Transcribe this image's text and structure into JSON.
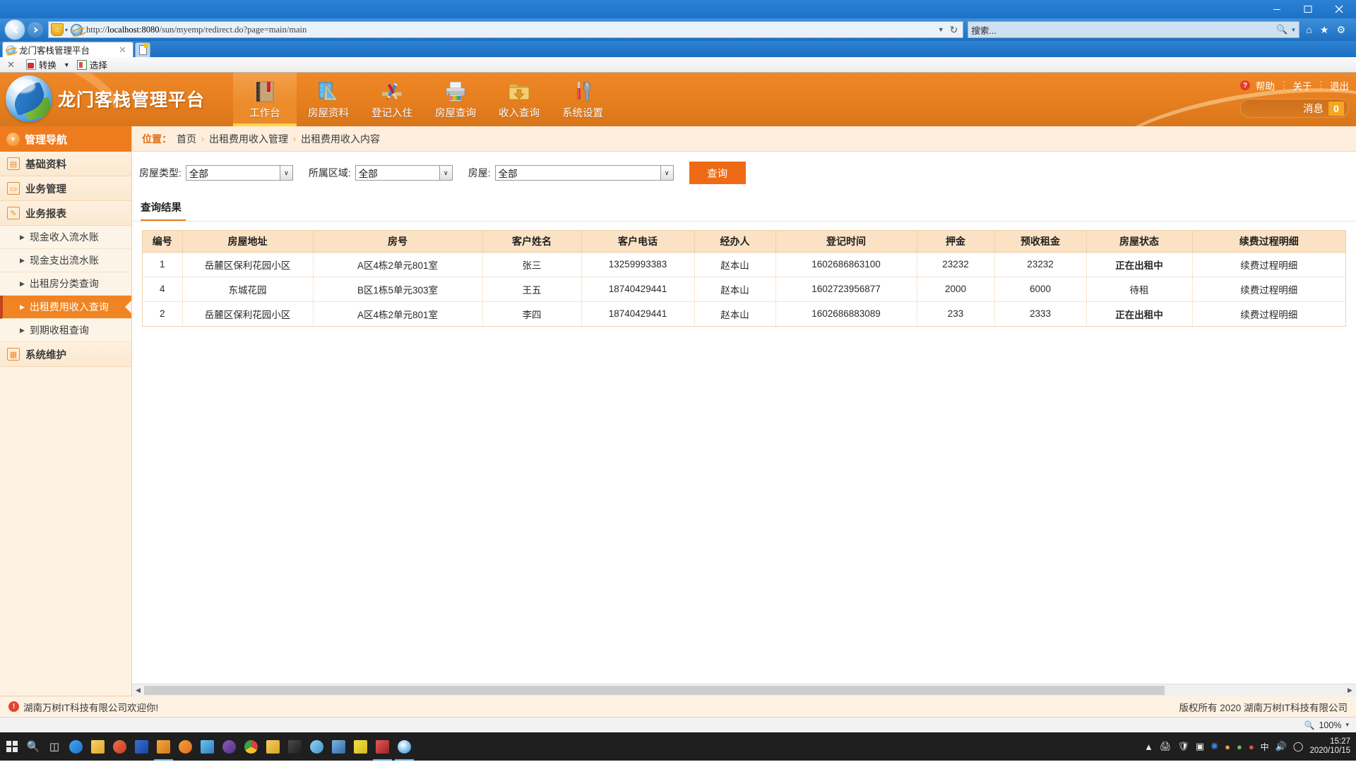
{
  "browser": {
    "url_prefix": "http://",
    "url_host": "localhost:8080",
    "url_path": "/sun/myemp/redirect.do?page=main/main",
    "url_full": "http://localhost:8080/sun/myemp/redirect.do?page=main/main",
    "search_placeholder": "搜索...",
    "tab_title": "龙门客栈管理平台",
    "tab_close": "✕",
    "addon_close": "✕",
    "addon_convert": "转换",
    "addon_select": "选择",
    "addon_caret": "▼",
    "minimize": "—",
    "maximize": "▢",
    "close": "✕",
    "refresh": "↻",
    "addr_caret": "▼",
    "search_caret": "▼",
    "icons": {
      "home": "⌂",
      "favorites": "★",
      "gear": "⚙"
    }
  },
  "app": {
    "title": "龙门客栈管理平台",
    "header_links": [
      {
        "label": "帮助",
        "icon": "question-mark"
      },
      {
        "label": "关于"
      },
      {
        "label": "退出"
      }
    ],
    "link_separator": "⋮",
    "help_badge": "?",
    "message_label": "消息",
    "message_count": "0",
    "nav": [
      {
        "label": "工作台",
        "icon": "notebook-icon",
        "active": true
      },
      {
        "label": "房屋资料",
        "icon": "ruler-triangle-icon",
        "active": false
      },
      {
        "label": "登记入住",
        "icon": "pencil-brush-icon",
        "active": false
      },
      {
        "label": "房屋查询",
        "icon": "printer-icon",
        "active": false
      },
      {
        "label": "收入查询",
        "icon": "folder-download-icon",
        "active": false
      },
      {
        "label": "系统设置",
        "icon": "wrench-screwdriver-icon",
        "active": false
      }
    ]
  },
  "sidebar": {
    "header": "管理导航",
    "groups": [
      {
        "label": "基础资料",
        "icon": "grid-icon",
        "type": "group"
      },
      {
        "label": "业务管理",
        "icon": "chat-icon",
        "type": "group"
      },
      {
        "label": "业务报表",
        "icon": "pencil-square-icon",
        "type": "group"
      },
      {
        "label": "现金收入流水账",
        "type": "sub",
        "active": false
      },
      {
        "label": "现金支出流水账",
        "type": "sub",
        "active": false
      },
      {
        "label": "出租房分类查询",
        "type": "sub",
        "active": false
      },
      {
        "label": "出租费用收入查询",
        "type": "sub",
        "active": true
      },
      {
        "label": "到期收租查询",
        "type": "sub",
        "active": false
      },
      {
        "label": "系统维护",
        "icon": "calendar-icon",
        "type": "group"
      }
    ],
    "sub_arrow": "▶"
  },
  "breadcrumb": {
    "label": "位置：",
    "items": [
      "首页",
      "出租费用收入管理",
      "出租费用收入内容"
    ],
    "separator": "›"
  },
  "filters": {
    "fields": [
      {
        "label": "房屋类型:",
        "value": "全部"
      },
      {
        "label": "所属区域:",
        "value": "全部"
      },
      {
        "label": "房屋:",
        "value": "全部"
      }
    ],
    "query_button": "查询",
    "select_caret": "∨"
  },
  "results": {
    "section_title": "查询结果",
    "columns": [
      "编号",
      "房屋地址",
      "房号",
      "客户姓名",
      "客户电话",
      "经办人",
      "登记时间",
      "押金",
      "预收租金",
      "房屋状态",
      "续费过程明细"
    ],
    "rows": [
      {
        "id": "1",
        "address": "岳麓区保利花园小区",
        "room": "A区4栋2单元801室",
        "customer": "张三",
        "phone": "13259993383",
        "agent": "赵本山",
        "reg_time": "1602686863100",
        "deposit": "23232",
        "prepaid_rent": "23232",
        "status": "正在出租中",
        "status_kind": "renting",
        "detail": "续费过程明细"
      },
      {
        "id": "4",
        "address": "东城花园",
        "room": "B区1栋5单元303室",
        "customer": "王五",
        "phone": "18740429441",
        "agent": "赵本山",
        "reg_time": "1602723956877",
        "deposit": "2000",
        "prepaid_rent": "6000",
        "status": "待租",
        "status_kind": "idle",
        "detail": "续费过程明细"
      },
      {
        "id": "2",
        "address": "岳麓区保利花园小区",
        "room": "A区4栋2单元801室",
        "customer": "李四",
        "phone": "18740429441",
        "agent": "赵本山",
        "reg_time": "1602686883089",
        "deposit": "233",
        "prepaid_rent": "2333",
        "status": "正在出租中",
        "status_kind": "renting",
        "detail": "续费过程明细"
      }
    ]
  },
  "footer": {
    "welcome": "湖南万树IT科技有限公司欢迎你!",
    "copyright": "版权所有 2020 湖南万树IT科技有限公司"
  },
  "statusbar": {
    "zoom": "100%",
    "zoom_caret": "▾"
  },
  "taskbar": {
    "start": "⊞",
    "search": "○",
    "taskview": "▯",
    "clock_time": "15:27",
    "clock_date": "2020/10/15",
    "ime": "中",
    "colors": {
      "accent_orange": "#ee7b1e",
      "header_orange": "#e8801f",
      "panel_cream": "#fdf1e2",
      "table_header": "#fbe2c4",
      "status_red": "#e60000",
      "query_button": "#ee6a14"
    }
  }
}
